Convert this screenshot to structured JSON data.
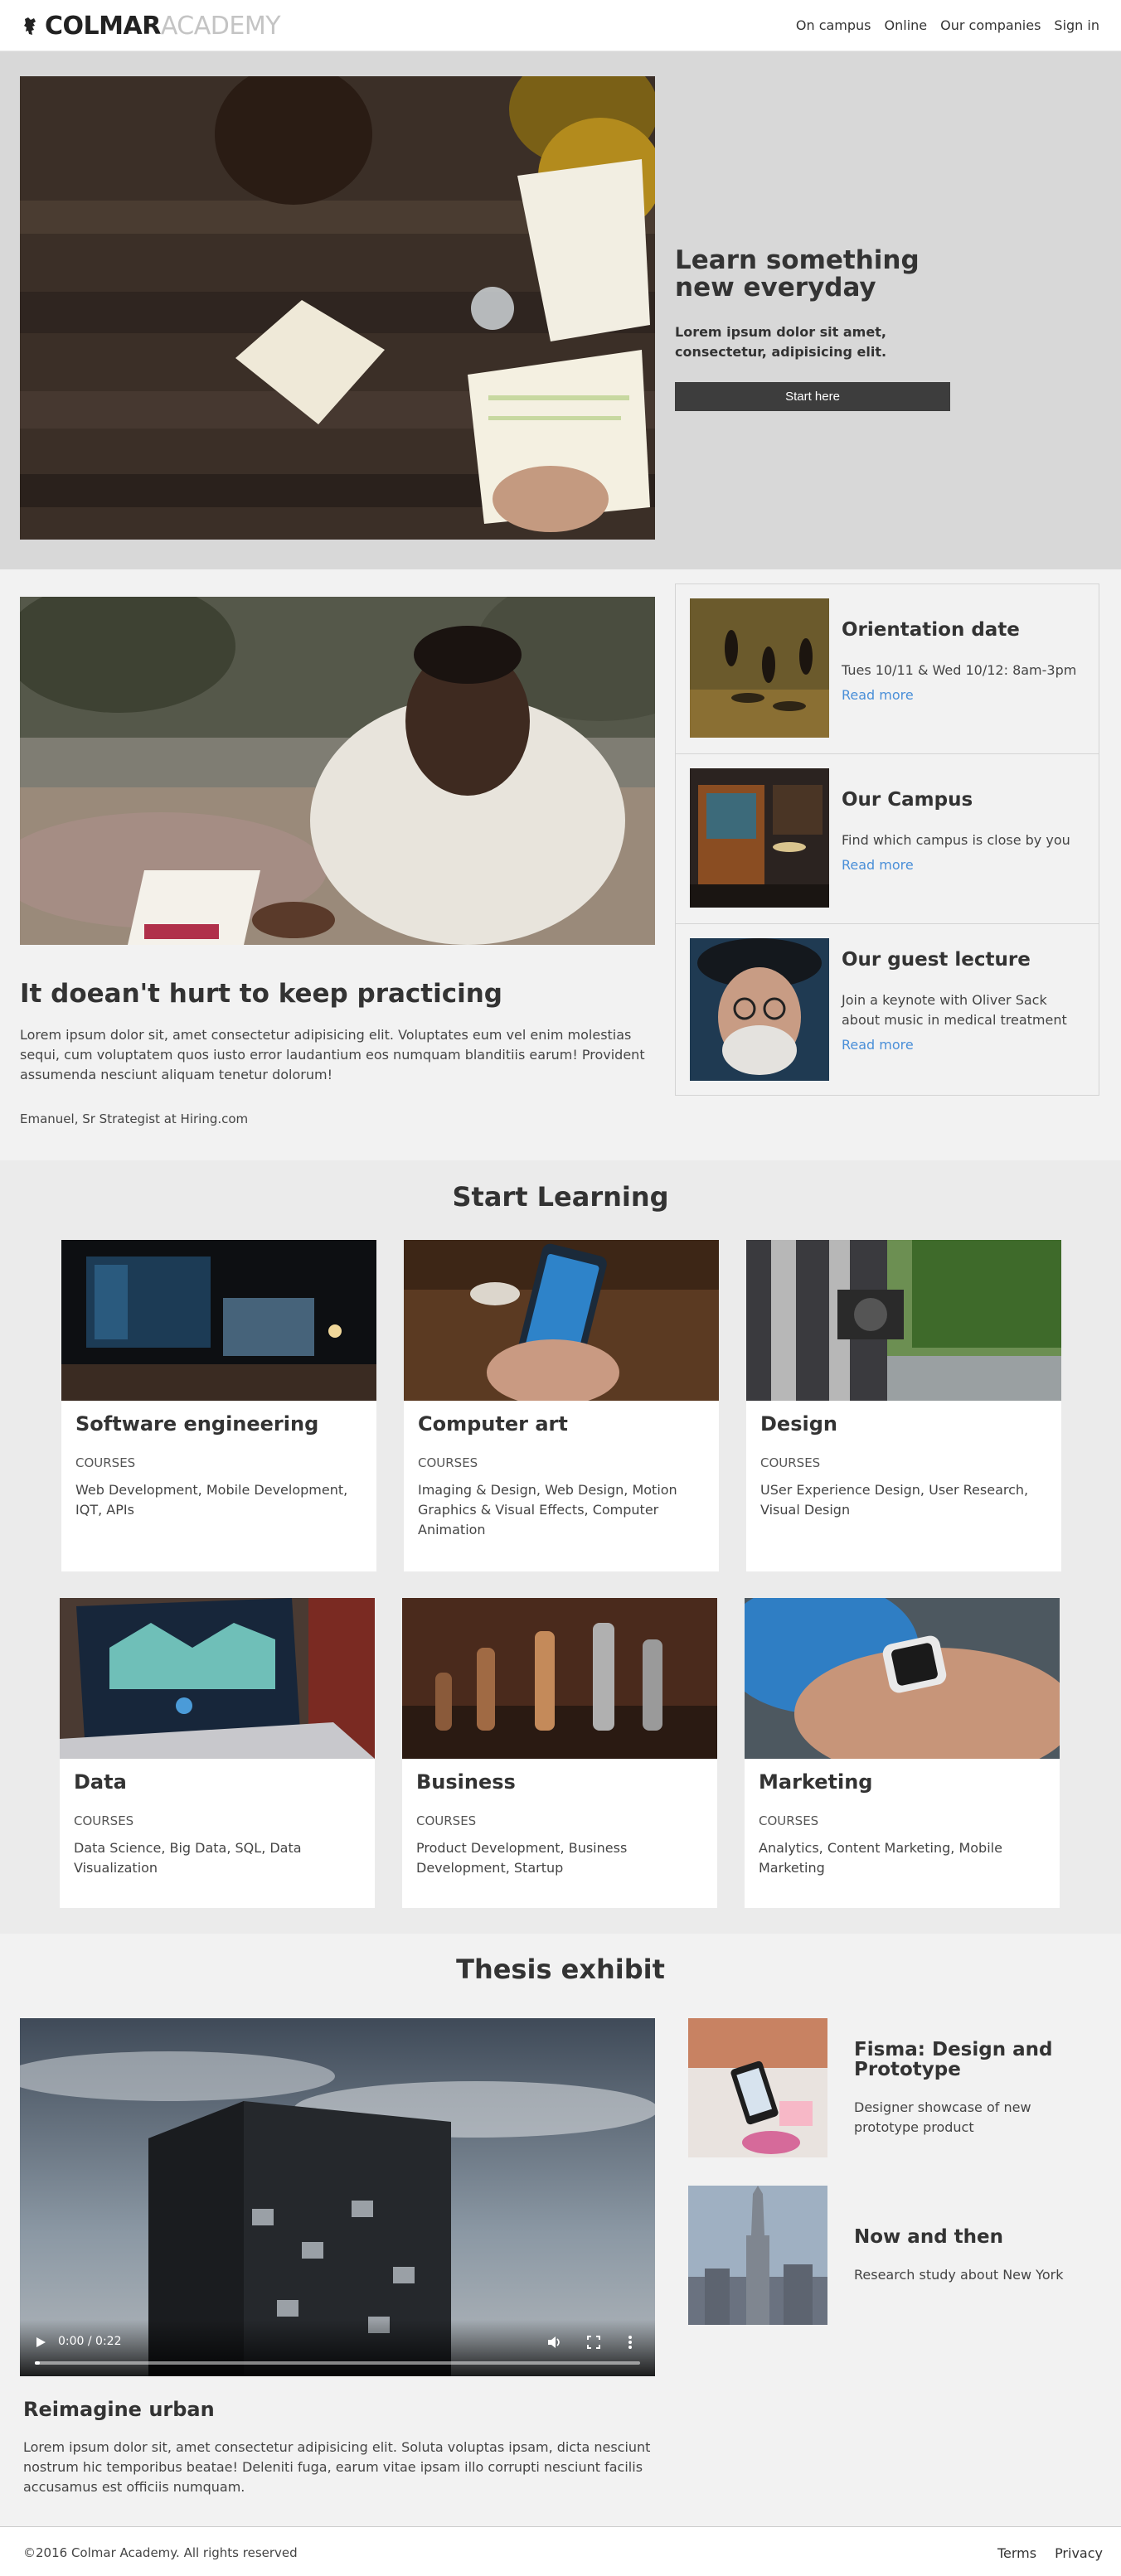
{
  "header": {
    "logo_bold": "COLMAR",
    "logo_light": "ACADEMY",
    "nav": [
      "On campus",
      "Online",
      "Our companies",
      "Sign in"
    ]
  },
  "hero": {
    "title": "Learn something new everyday",
    "subtitle": "Lorem ipsum dolor sit amet, consectetur, adipisicing elit.",
    "button": "Start here"
  },
  "practice": {
    "title": "It doean't hurt to keep practicing",
    "body": "Lorem ipsum dolor sit, amet consectetur adipisicing elit. Voluptates eum vel enim molestias sequi, cum voluptatem quos iusto error laudantium eos numquam blanditiis earum! Provident assumenda nesciunt aliquam tenetur dolorum!",
    "author": "Emanuel, Sr Strategist at Hiring.com"
  },
  "events": [
    {
      "title": "Orientation date",
      "desc": "Tues 10/11 & Wed 10/12: 8am-3pm",
      "link": "Read more"
    },
    {
      "title": "Our Campus",
      "desc": "Find which campus is close by you",
      "link": "Read more"
    },
    {
      "title": "Our guest lecture",
      "desc": "Join a keynote with Oliver Sack about music in medical treatment",
      "link": "Read more"
    }
  ],
  "learning": {
    "title": "Start Learning",
    "kicker": "COURSES",
    "cards": [
      {
        "title": "Software engineering",
        "courses": "Web Development, Mobile Development, IQT, APIs"
      },
      {
        "title": "Computer art",
        "courses": "Imaging & Design, Web Design, Motion Graphics & Visual Effects, Computer Animation"
      },
      {
        "title": "Design",
        "courses": "USer Experience Design, User Research, Visual Design"
      },
      {
        "title": "Data",
        "courses": "Data Science, Big Data, SQL, Data Visualization"
      },
      {
        "title": "Business",
        "courses": "Product Development, Business Development, Startup"
      },
      {
        "title": "Marketing",
        "courses": "Analytics, Content Marketing, Mobile Marketing"
      }
    ]
  },
  "thesis": {
    "title": "Thesis exhibit",
    "video_time": "0:00 / 0:22",
    "video_progress": 0.0,
    "main_title": "Reimagine urban",
    "main_body": "Lorem ipsum dolor sit, amet consectetur adipisicing elit. Soluta voluptas ipsam, dicta nesciunt nostrum hic temporibus beatae! Deleniti fuga, earum vitae ipsam illo corrupti nesciunt facilis accusamus est officiis numquam.",
    "exhibits": [
      {
        "title": "Fisma: Design and Prototype",
        "desc": "Designer showcase of new prototype product"
      },
      {
        "title": "Now and then",
        "desc": "Research study about New York"
      }
    ]
  },
  "footer": {
    "copyright": "©2016 Colmar Academy. All rights reserved",
    "links": [
      "Terms",
      "Privacy"
    ]
  },
  "colors": {
    "link": "#4a8fd8",
    "button": "#3d3d3d",
    "hero_bg": "#d8d8d8",
    "learning_bg": "#ebebeb"
  }
}
